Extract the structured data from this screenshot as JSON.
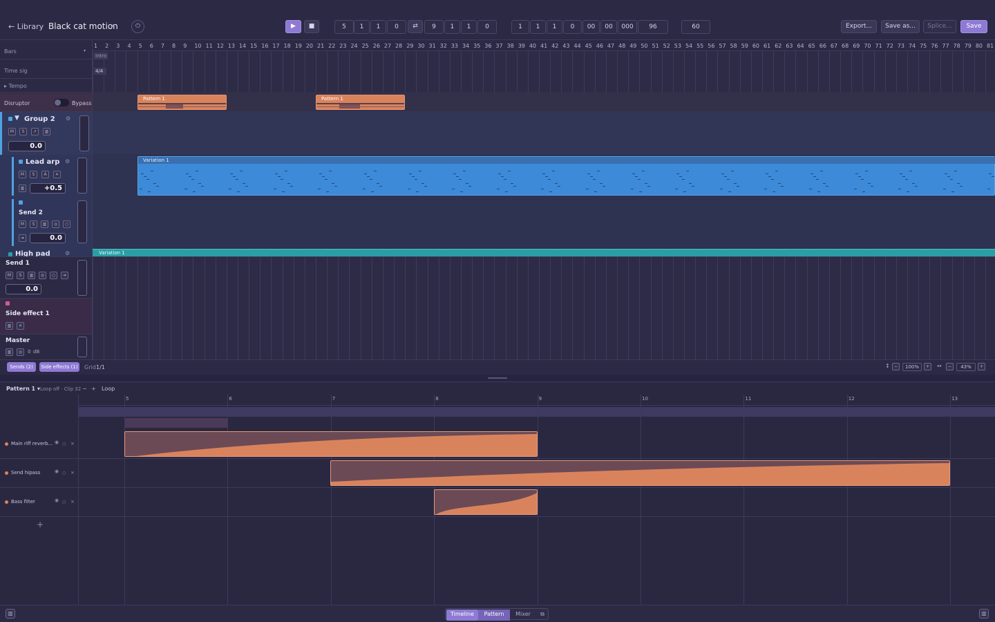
{
  "header": {
    "back_label": "← Library",
    "project_title": "Black cat motion",
    "title_caret": "▾",
    "transport": {
      "play_icon": "▶",
      "stop_icon": "■",
      "position": [
        "5",
        "1",
        "1",
        "0"
      ],
      "loop_icon": "⇄",
      "loop_end": [
        "9",
        "1",
        "1",
        "0"
      ],
      "time": [
        "1",
        "1",
        "1",
        "0",
        "00",
        "00",
        "000"
      ],
      "ppq": "96",
      "tempo": "60"
    },
    "export_label": "Export...",
    "save_as_label": "Save as...",
    "splice_label": "Splice...",
    "save_label": "Save"
  },
  "ruler": {
    "bars": [
      "1",
      "2",
      "3",
      "4",
      "5",
      "6",
      "7",
      "8",
      "9",
      "10",
      "11",
      "12",
      "13",
      "14",
      "15",
      "16",
      "17",
      "18",
      "19",
      "20",
      "21",
      "22",
      "23",
      "24",
      "25",
      "26",
      "27",
      "28",
      "29",
      "30",
      "31",
      "32",
      "33",
      "34",
      "35",
      "36",
      "37",
      "38",
      "39",
      "40",
      "41",
      "42",
      "43",
      "44",
      "45",
      "46",
      "47",
      "48",
      "49",
      "50",
      "51",
      "52",
      "53",
      "54",
      "55",
      "56",
      "57",
      "58",
      "59",
      "60",
      "61",
      "62",
      "63",
      "64",
      "65",
      "66",
      "67",
      "68",
      "69",
      "70",
      "71",
      "72",
      "73",
      "74",
      "75",
      "76",
      "77",
      "78",
      "79",
      "80",
      "81"
    ]
  },
  "left_panel": {
    "bars_label": "Bars",
    "timesig_label": "Time sig",
    "timesig_value": "4/4",
    "intro_marker": "Intro",
    "tempo_label": "▸ Tempo",
    "disruptor_label": "Disruptor",
    "bypass_label": "Bypass",
    "tracks": [
      {
        "name": "Group 2",
        "value": "0.0",
        "buttons": [
          "M",
          "S",
          "↗",
          "▥"
        ]
      },
      {
        "name": "Lead arp",
        "value": "+0.5",
        "buttons": [
          "M",
          "S",
          "A",
          "✕"
        ]
      },
      {
        "name": "Send 2",
        "value": "0.0",
        "buttons": [
          "M",
          "S",
          "▥",
          "◎",
          "○"
        ]
      },
      {
        "name": "High pad"
      },
      {
        "name": "Send 1",
        "value": "0.0",
        "buttons": [
          "M",
          "S",
          "▥",
          "◎",
          "○",
          "➔"
        ]
      },
      {
        "name": "Side effect 1",
        "buttons": [
          "▥",
          "✕"
        ]
      },
      {
        "name": "Master",
        "db_value": "0",
        "db_unit": "dB",
        "buttons": [
          "▥",
          "◎"
        ]
      }
    ]
  },
  "clips": {
    "pattern1_a": "Pattern 1",
    "pattern1_b": "Pattern 1",
    "variation_lead": "Variation 1",
    "variation_pad": "Variation 1"
  },
  "bottom_strip": {
    "sends_label": "Sends (2)",
    "side_effects_label": "Side effects (1)",
    "grid_label": "Grid",
    "grid_value": "1/1",
    "zoom_v": "100%",
    "zoom_h": "43%"
  },
  "editor": {
    "pattern_label": "Pattern 1 ▾",
    "loop_info": "Loop off · Clip 32",
    "minus": "−",
    "plus": "+",
    "loop_label": "Loop",
    "ruler_marks": [
      "5",
      "6",
      "7",
      "8",
      "9",
      "10",
      "11",
      "12",
      "13"
    ],
    "lanes": [
      {
        "name": "Main riff reverb..."
      },
      {
        "name": "Send hipass"
      },
      {
        "name": "Bass filter"
      }
    ],
    "add_lane": "+"
  },
  "footer": {
    "tabs": [
      "Timeline",
      "Pattern",
      "Mixer"
    ],
    "active_tab": "Pattern",
    "popout_icon": "⧉"
  },
  "colors": {
    "accent": "#8e7ad4",
    "clip_orange": "#d9835d",
    "clip_blue": "#3d8ad8",
    "clip_teal": "#2a9ea5",
    "group_blue": "#4fa3e0",
    "sidefx_pink": "#d05a9a"
  }
}
